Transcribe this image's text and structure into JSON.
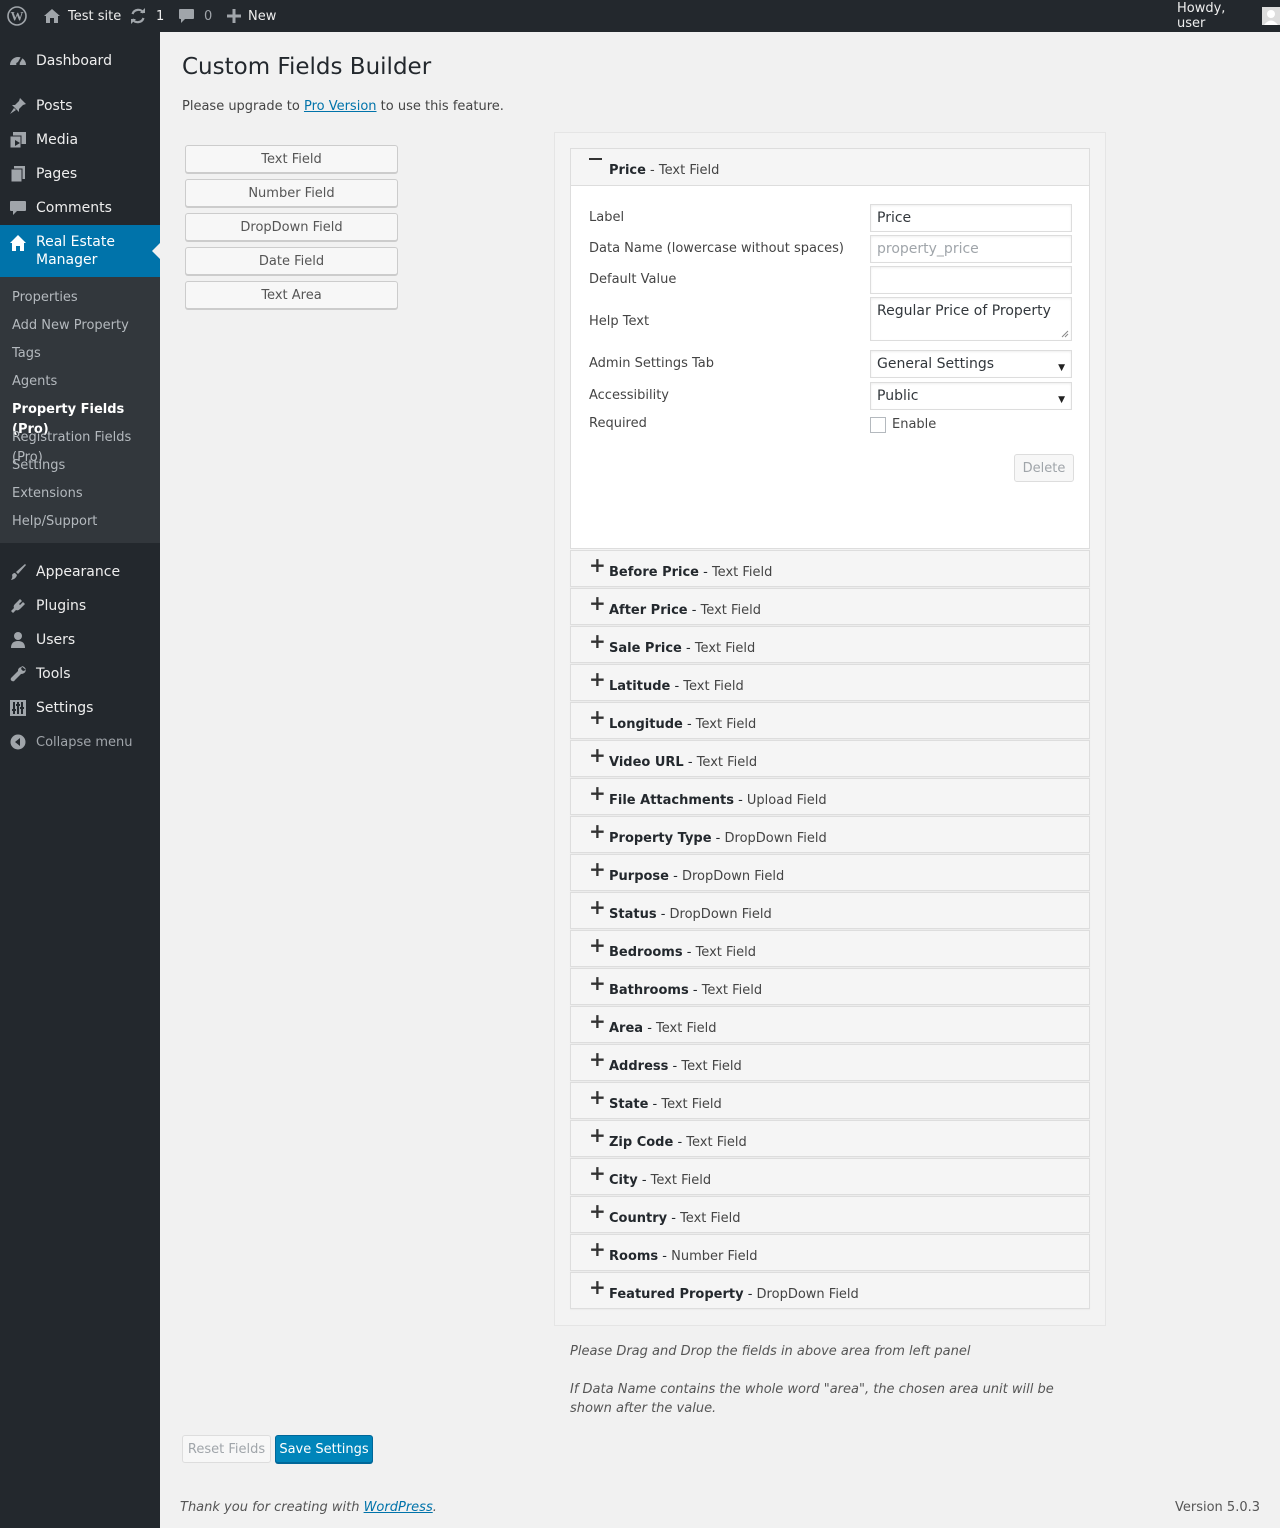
{
  "adminbar": {
    "site_name": "Test site",
    "updates_count": "1",
    "comments_count": "0",
    "new_label": "New",
    "howdy": "Howdy, user"
  },
  "sidebar": {
    "items": [
      {
        "label": "Dashboard",
        "icon": "dashboard-icon"
      },
      {
        "label": "Posts",
        "icon": "pin-icon"
      },
      {
        "label": "Media",
        "icon": "media-icon"
      },
      {
        "label": "Pages",
        "icon": "pages-icon"
      },
      {
        "label": "Comments",
        "icon": "comment-icon"
      },
      {
        "label": "Real Estate Manager",
        "icon": "home-icon"
      },
      {
        "label": "Appearance",
        "icon": "brush-icon"
      },
      {
        "label": "Plugins",
        "icon": "plugin-icon"
      },
      {
        "label": "Users",
        "icon": "user-icon"
      },
      {
        "label": "Tools",
        "icon": "wrench-icon"
      },
      {
        "label": "Settings",
        "icon": "sliders-icon"
      }
    ],
    "submenu": [
      "Properties",
      "Add New Property",
      "Tags",
      "Agents",
      "Property Fields (Pro)",
      "Registration Fields (Pro)",
      "Settings",
      "Extensions",
      "Help/Support"
    ],
    "collapse_label": "Collapse menu"
  },
  "page": {
    "title": "Custom Fields Builder",
    "notice_before": "Please upgrade to ",
    "notice_link": "Pro Version",
    "notice_after": " to use this feature."
  },
  "field_types": [
    "Text Field",
    "Number Field",
    "DropDown Field",
    "Date Field",
    "Text Area"
  ],
  "open_field": {
    "name": "Price",
    "type": "Text Field",
    "labels": {
      "label": "Label",
      "data_name": "Data Name (lowercase without spaces)",
      "default_value": "Default Value",
      "help_text": "Help Text",
      "admin_tab": "Admin Settings Tab",
      "accessibility": "Accessibility",
      "required": "Required"
    },
    "values": {
      "label": "Price",
      "data_name_placeholder": "property_price",
      "default_value": "",
      "help_text": "Regular Price of Property",
      "admin_tab": "General Settings",
      "accessibility": "Public",
      "required_option": "Enable"
    },
    "delete_label": "Delete"
  },
  "fields": [
    {
      "name": "Before Price",
      "type": "Text Field"
    },
    {
      "name": "After Price",
      "type": "Text Field"
    },
    {
      "name": "Sale Price",
      "type": "Text Field"
    },
    {
      "name": "Latitude",
      "type": "Text Field"
    },
    {
      "name": "Longitude",
      "type": "Text Field"
    },
    {
      "name": "Video URL",
      "type": "Text Field"
    },
    {
      "name": "File Attachments",
      "type": "Upload Field"
    },
    {
      "name": "Property Type",
      "type": "DropDown Field"
    },
    {
      "name": "Purpose",
      "type": "DropDown Field"
    },
    {
      "name": "Status",
      "type": "DropDown Field"
    },
    {
      "name": "Bedrooms",
      "type": "Text Field"
    },
    {
      "name": "Bathrooms",
      "type": "Text Field"
    },
    {
      "name": "Area",
      "type": "Text Field"
    },
    {
      "name": "Address",
      "type": "Text Field"
    },
    {
      "name": "State",
      "type": "Text Field"
    },
    {
      "name": "Zip Code",
      "type": "Text Field"
    },
    {
      "name": "City",
      "type": "Text Field"
    },
    {
      "name": "Country",
      "type": "Text Field"
    },
    {
      "name": "Rooms",
      "type": "Number Field"
    },
    {
      "name": "Featured Property",
      "type": "DropDown Field"
    }
  ],
  "hints": [
    "Please Drag and Drop the fields in above area from left panel",
    "If Data Name contains the whole word \"area\", the chosen area unit will be shown after the value."
  ],
  "buttons": {
    "reset": "Reset Fields",
    "save": "Save Settings"
  },
  "footer": {
    "thanks_before": "Thank you for creating with ",
    "thanks_link": "WordPress",
    "thanks_after": ".",
    "version": "Version 5.0.3"
  },
  "colors": {
    "admin_dark": "#23282d",
    "accent": "#0073aa",
    "primary_button": "#0085ba"
  }
}
